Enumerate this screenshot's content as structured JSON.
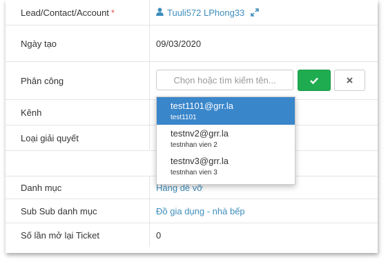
{
  "rows": {
    "lead": {
      "label": "Lead/Contact/Account",
      "required": "*",
      "value": "Tuuli572 LPhong33"
    },
    "created": {
      "label": "Ngày tạo",
      "value": "09/03/2020"
    },
    "assign": {
      "label": "Phân công",
      "placeholder": "Chọn hoặc tìm kiếm tên..."
    },
    "channel": {
      "label": "Kênh"
    },
    "resolution": {
      "label": "Loại giải quyết"
    },
    "category": {
      "label": "Danh mục",
      "value": "Hàng dễ vỡ"
    },
    "subsub": {
      "label": "Sub Sub danh mục",
      "value": "Đồ gia dụng - nhà bếp"
    },
    "reopen": {
      "label": "Số lần mở lại Ticket",
      "value": "0"
    }
  },
  "dropdown": {
    "options": [
      {
        "email": "test1101@grr.la",
        "name": "test1101"
      },
      {
        "email": "testnv2@grr.la",
        "name": "testnhan vien 2"
      },
      {
        "email": "testnv3@grr.la",
        "name": "testnhan vien 3"
      }
    ]
  },
  "colors": {
    "link": "#3c8dbc",
    "confirm": "#1fac50",
    "selected": "#3a86cb",
    "required": "#d9534f"
  }
}
